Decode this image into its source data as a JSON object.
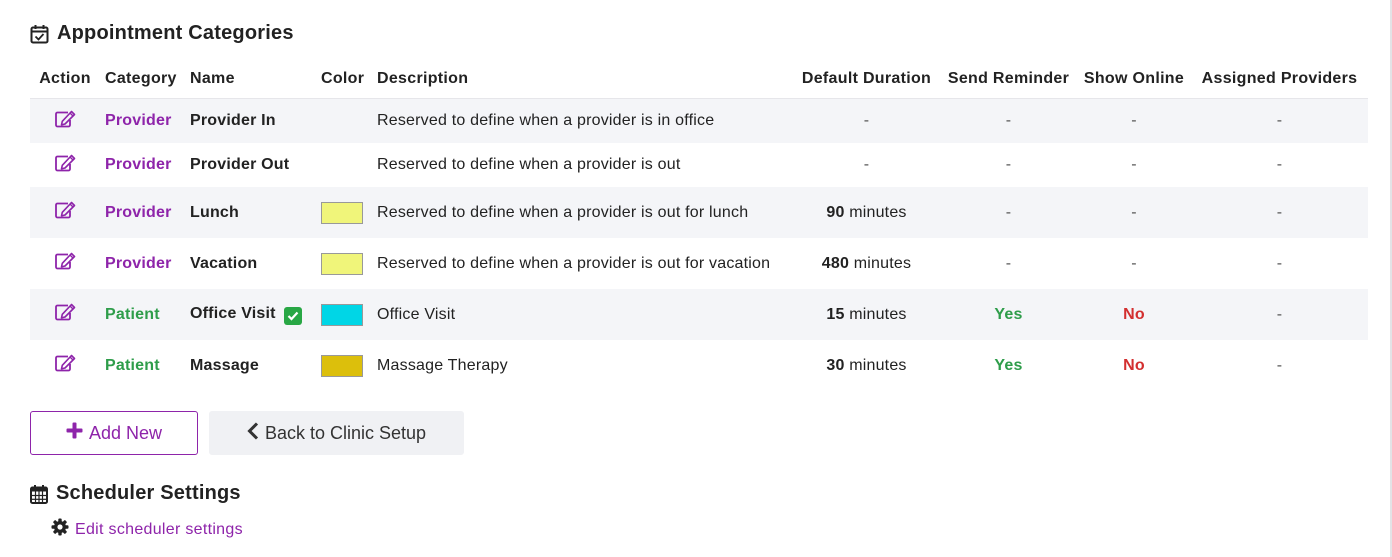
{
  "appointment_categories": {
    "title": "Appointment Categories",
    "columns": {
      "action": "Action",
      "category": "Category",
      "name": "Name",
      "color": "Color",
      "description": "Description",
      "default_duration": "Default Duration",
      "send_reminder": "Send Reminder",
      "show_online": "Show Online",
      "assigned_providers": "Assigned Providers"
    },
    "rows": [
      {
        "category": "Provider",
        "name": "Provider In",
        "description": "Reserved to define when a provider is in office",
        "duration_value": "-",
        "duration_unit": "",
        "send_reminder": "-",
        "show_online": "-",
        "assigned_providers": "-"
      },
      {
        "category": "Provider",
        "name": "Provider Out",
        "description": "Reserved to define when a provider is out",
        "duration_value": "-",
        "duration_unit": "",
        "send_reminder": "-",
        "show_online": "-",
        "assigned_providers": "-"
      },
      {
        "category": "Provider",
        "name": "Lunch",
        "color": "#f0f57a",
        "description": "Reserved to define when a provider is out for lunch",
        "duration_value": "90",
        "duration_unit": "minutes",
        "send_reminder": "-",
        "show_online": "-",
        "assigned_providers": "-"
      },
      {
        "category": "Provider",
        "name": "Vacation",
        "color": "#f0f57a",
        "description": "Reserved to define when a provider is out for vacation",
        "duration_value": "480",
        "duration_unit": "minutes",
        "send_reminder": "-",
        "show_online": "-",
        "assigned_providers": "-"
      },
      {
        "category": "Patient",
        "name": "Office Visit",
        "online_bookable": true,
        "color": "#00d6e6",
        "description": "Office Visit",
        "duration_value": "15",
        "duration_unit": "minutes",
        "send_reminder": "Yes",
        "show_online": "No",
        "assigned_providers": "-"
      },
      {
        "category": "Patient",
        "name": "Massage",
        "color": "#dcbf0c",
        "description": "Massage Therapy",
        "duration_value": "30",
        "duration_unit": "minutes",
        "send_reminder": "Yes",
        "show_online": "No",
        "assigned_providers": "-"
      }
    ]
  },
  "buttons": {
    "add_new": "Add New",
    "back_to_setup": "Back to Clinic Setup"
  },
  "scheduler_settings": {
    "title": "Scheduler Settings",
    "edit_link": "Edit scheduler settings"
  },
  "colors": {
    "accent_purple": "#8e24aa",
    "patient_green": "#2e9d4a",
    "no_red": "#d32f2f"
  },
  "icons": {
    "section_1": "calendar-check-icon",
    "section_2": "calendar-icon",
    "row_action": "edit-icon",
    "add": "plus-icon",
    "back": "chevron-left-icon",
    "settings": "gear-icon",
    "online": "check-square-icon"
  }
}
